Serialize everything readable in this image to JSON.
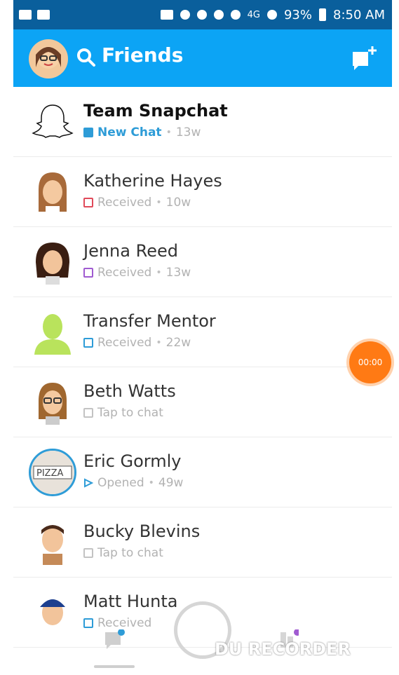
{
  "status_bar": {
    "network": "4G",
    "battery": "93%",
    "time": "8:50 AM"
  },
  "header": {
    "title": "Friends"
  },
  "friends": [
    {
      "name": "Team Snapchat",
      "status": "New Chat",
      "time": "13w",
      "status_color": "#2e9cd7",
      "highlight": true
    },
    {
      "name": "Katherine Hayes",
      "status": "Received",
      "time": "10w",
      "status_color": "#e04a5a"
    },
    {
      "name": "Jenna Reed",
      "status": "Received",
      "time": "13w",
      "status_color": "#a05bd1"
    },
    {
      "name": "Transfer Mentor",
      "status": "Received",
      "time": "22w",
      "status_color": "#2e9cd7"
    },
    {
      "name": "Beth Watts",
      "status": "Tap to chat",
      "time": "",
      "status_color": "#c3c3c3"
    },
    {
      "name": "Eric Gormly",
      "status": "Opened",
      "time": "49w",
      "status_color": "#2e9cd7"
    },
    {
      "name": "Bucky Blevins",
      "status": "Tap to chat",
      "time": "",
      "status_color": "#c3c3c3"
    },
    {
      "name": "Matt Hunta",
      "status": "Received",
      "time": "",
      "status_color": "#2e9cd7"
    }
  ],
  "timer": "00:00",
  "watermark": "DU RECORDER",
  "colors": {
    "header": "#0ca4f5",
    "status_bar": "#0a5f9c",
    "timer": "#ff7a14"
  }
}
